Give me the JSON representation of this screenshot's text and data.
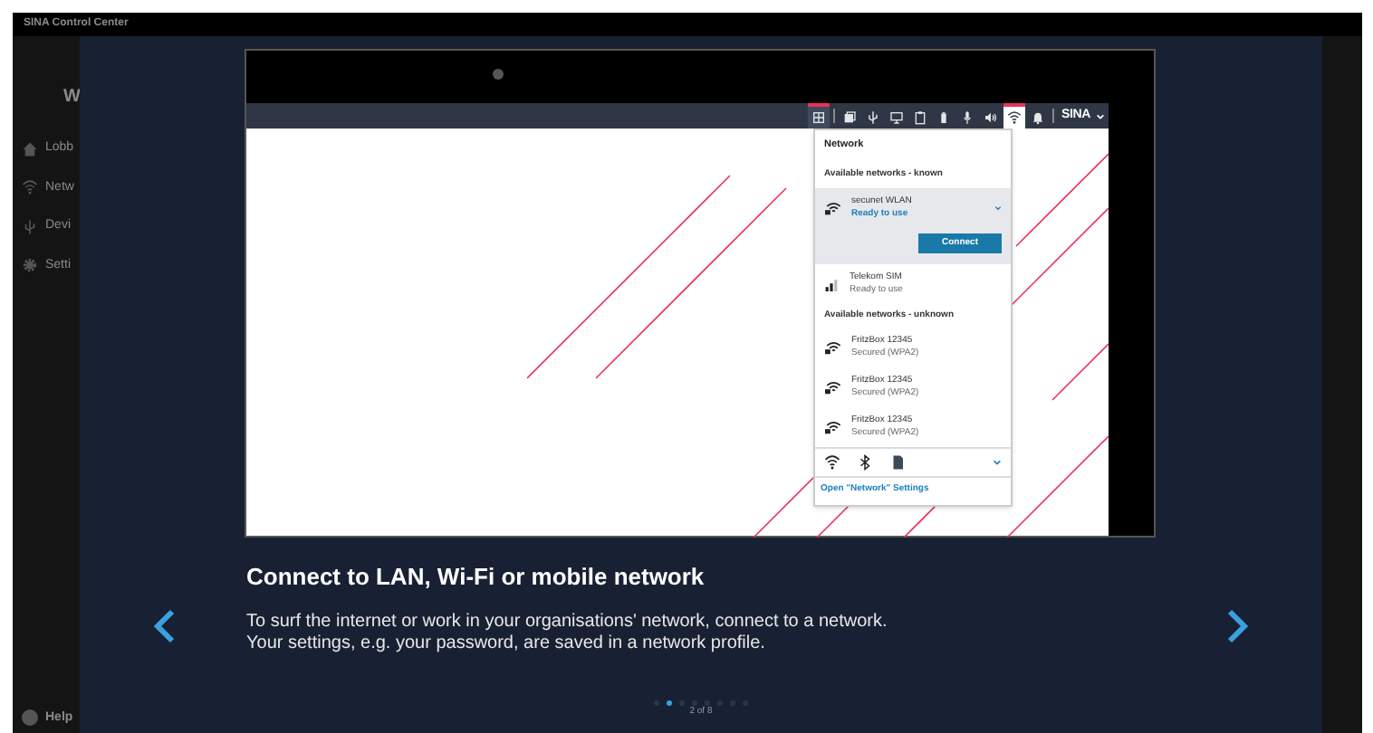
{
  "app": {
    "title": "SINA Control Center",
    "logo": "W",
    "sidebar": [
      {
        "kind": "home",
        "label": "Lobb"
      },
      {
        "kind": "wifi",
        "label": "Netw"
      },
      {
        "kind": "usb",
        "label": "Devi"
      },
      {
        "kind": "gear",
        "label": "Setti"
      }
    ],
    "help": "Help"
  },
  "tour": {
    "screenshot": {
      "taskbar": [
        {
          "kind": "grid",
          "selected": true
        },
        {
          "kind": "windows",
          "selected": false
        },
        {
          "kind": "usb",
          "selected": false
        },
        {
          "kind": "monitor",
          "selected": false
        },
        {
          "kind": "clipboard",
          "selected": false
        },
        {
          "kind": "battery",
          "selected": false
        },
        {
          "kind": "mic",
          "selected": false
        },
        {
          "kind": "speaker",
          "selected": false
        },
        {
          "kind": "wifi",
          "selected": true
        },
        {
          "kind": "bell",
          "selected": false
        }
      ],
      "logo": "SINA",
      "popup": {
        "title": "Network",
        "sections": [
          {
            "heading": "Available networks - known",
            "networks": [
              {
                "kind": "wifi",
                "name": "secunet WLAN",
                "status": "Ready to use",
                "selected": true,
                "action": "Connect"
              },
              {
                "kind": "cellular",
                "name": "Telekom SIM",
                "status": "Ready to use",
                "selected": false
              }
            ]
          },
          {
            "heading": "Available networks - unknown",
            "networks": [
              {
                "kind": "wifi",
                "name": "FritzBox 12345",
                "status": "Secured (WPA2)",
                "selected": false
              },
              {
                "kind": "wifi",
                "name": "FritzBox 12345",
                "status": "Secured (WPA2)",
                "selected": false
              },
              {
                "kind": "wifi",
                "name": "FritzBox 12345",
                "status": "Secured (WPA2)",
                "selected": false
              }
            ]
          }
        ],
        "link": "Open \"Network\" Settings"
      }
    },
    "title": "Connect to LAN, Wi-Fi or mobile network",
    "text": [
      "To surf the internet or work in your organisations' network, connect to a network.",
      "Your settings, e.g. your password, are saved in a network profile."
    ],
    "pages": [
      {
        "selected": false
      },
      {
        "selected": true
      },
      {
        "selected": false
      },
      {
        "selected": false
      },
      {
        "selected": false
      },
      {
        "selected": false
      },
      {
        "selected": false
      },
      {
        "selected": false
      }
    ],
    "counter": "2 of 8"
  }
}
